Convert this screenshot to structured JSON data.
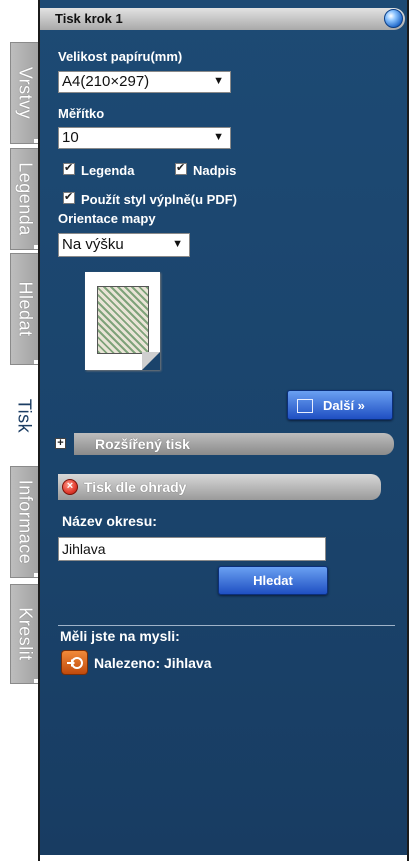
{
  "title": "Tisk krok 1",
  "tabs": [
    {
      "label": "Vrstvy",
      "active": false
    },
    {
      "label": "Legenda",
      "active": false
    },
    {
      "label": "Hledat",
      "active": false
    },
    {
      "label": "Tisk",
      "active": true
    },
    {
      "label": "Informace",
      "active": false
    },
    {
      "label": "Kreslit",
      "active": false
    }
  ],
  "paper_size": {
    "label": "Velikost papíru(mm)",
    "value": "A4(210×297)"
  },
  "scale": {
    "label": "Měřítko",
    "value": "10"
  },
  "options": {
    "legend": "Legenda",
    "title": "Nadpis",
    "fill_style": "Použít styl výplně(u PDF)"
  },
  "orientation": {
    "label": "Orientace mapy",
    "value": "Na výšku"
  },
  "next_button": "Další »",
  "advanced_print": "Rozšířený tisk",
  "print_by_boundary": {
    "title": "Tisk dle ohrady",
    "district_label": "Název okresu:",
    "district_value": "Jihlava",
    "search_button": "Hledat"
  },
  "suggestions": {
    "heading": "Měli jste na mysli:",
    "result": "Nalezeno: Jihlava"
  },
  "colors": {
    "panel": "#1a436b",
    "tab_grey": "#a9a9a9",
    "button_blue": "#1f4fc2",
    "close_red": "#e23b2e"
  }
}
